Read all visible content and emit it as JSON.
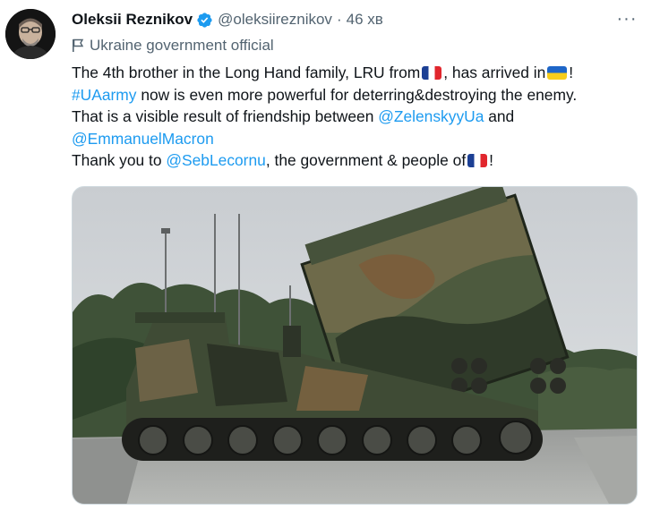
{
  "tweet": {
    "author_name": "Oleksii Reznikov",
    "handle": "@oleksiireznikov",
    "separator": "·",
    "time": "46 хв",
    "more_label": "···",
    "label": "Ukraine government official",
    "text": {
      "line1_a": "The 4th brother in the Long Hand family, LRU from",
      "line1_b": ", has arrived in",
      "line1_c": "!",
      "line2_hashtag": "#UAarmy",
      "line2_rest": " now is even more powerful for deterring&destroying the enemy.",
      "line3_a": "That is a visible result of friendship between ",
      "line3_mention": "@ZelenskyyUa",
      "line3_b": " and",
      "line4_mention": "@EmmanuelMacron",
      "line5_a": "Thank you to ",
      "line5_mention": "@SebLecornu",
      "line5_b": ", the government & people of",
      "line5_c": "!"
    },
    "icons": {
      "verified": "verified-badge-icon",
      "label": "flag-icon",
      "emoji_france": "france-flag-emoji",
      "emoji_ukraine": "ukraine-flag-emoji"
    },
    "colors": {
      "link": "#1d9bf0",
      "secondary": "#536471",
      "verified": "#1d9bf0"
    }
  }
}
